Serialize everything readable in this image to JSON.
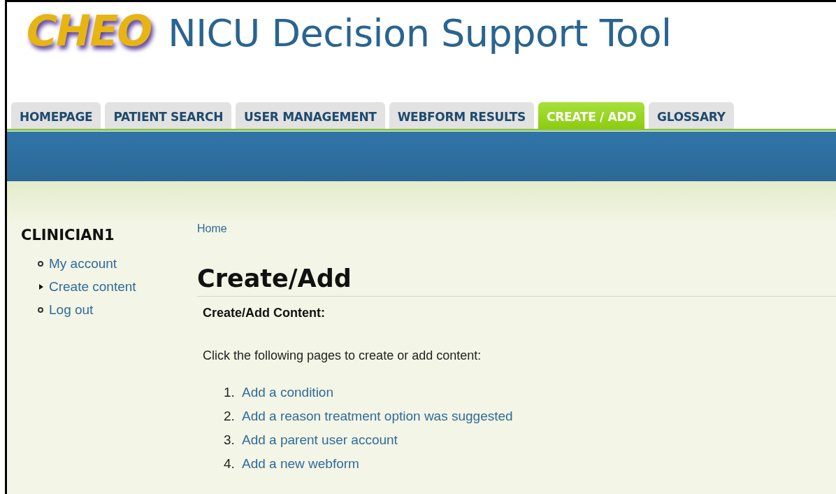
{
  "header": {
    "logo": "CHEO",
    "title": "NICU Decision Support Tool"
  },
  "tabs": [
    {
      "label": "HOMEPAGE",
      "selected": false
    },
    {
      "label": "PATIENT SEARCH",
      "selected": false
    },
    {
      "label": "USER MANAGEMENT",
      "selected": false
    },
    {
      "label": "WEBFORM RESULTS",
      "selected": false
    },
    {
      "label": "CREATE / ADD",
      "selected": true
    },
    {
      "label": "GLOSSARY",
      "selected": false
    }
  ],
  "sidebar": {
    "title": "CLINICIAN1",
    "items": [
      {
        "label": "My account",
        "kind": "leaf"
      },
      {
        "label": "Create content",
        "kind": "collapsed"
      },
      {
        "label": "Log out",
        "kind": "leaf"
      }
    ]
  },
  "breadcrumb": "Home",
  "page_title": "Create/Add",
  "content": {
    "heading": "Create/Add Content:",
    "intro": "Click the following pages to create or add content:",
    "links": [
      {
        "number": "1.",
        "label": "Add a condition"
      },
      {
        "number": "2.",
        "label": "Add a reason treatment option was suggested"
      },
      {
        "number": "3.",
        "label": "Add a parent user account"
      },
      {
        "number": "4.",
        "label": "Add a new webform"
      }
    ]
  }
}
